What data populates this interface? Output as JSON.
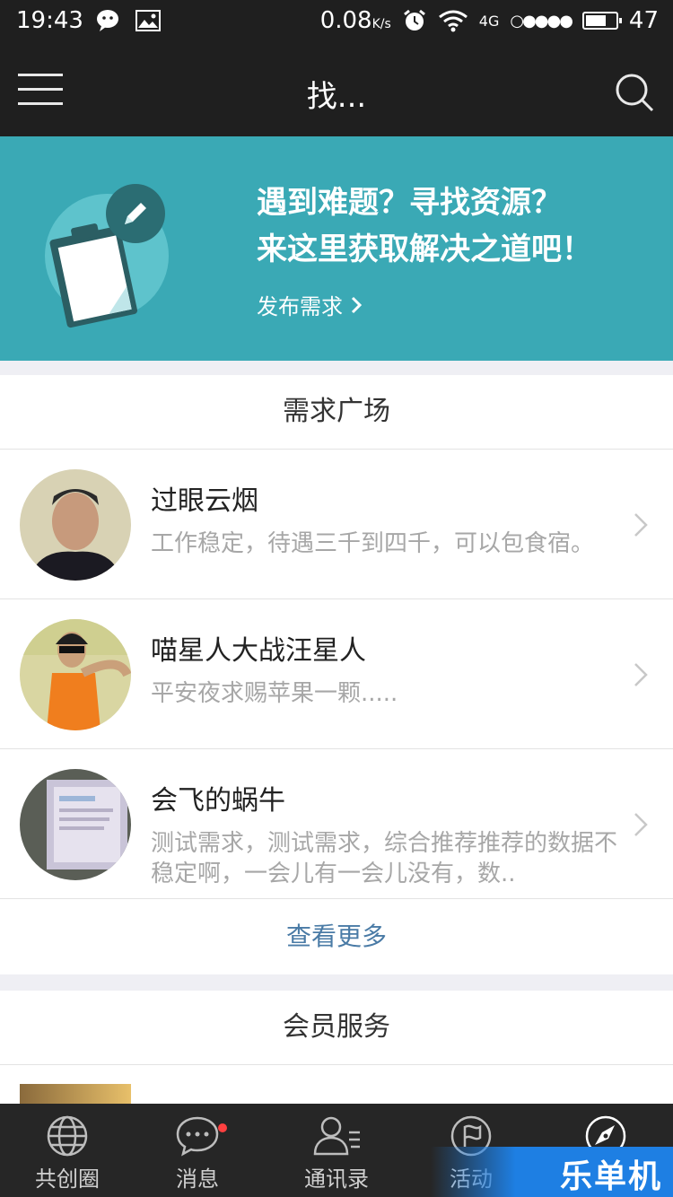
{
  "status_bar": {
    "time": "19:43",
    "net_speed": "0.08",
    "net_speed_unit": "K/s",
    "network": "4G",
    "battery": "47"
  },
  "header": {
    "title": "找..."
  },
  "banner": {
    "line1": "遇到难题？寻找资源？",
    "line2": "来这里获取解决之道吧！",
    "publish_label": "发布需求"
  },
  "demand_square": {
    "title": "需求广场",
    "items": [
      {
        "name": "过眼云烟",
        "desc": "工作稳定，待遇三千到四千，可以包食宿。"
      },
      {
        "name": "喵星人大战汪星人",
        "desc": "平安夜求赐苹果一颗....."
      },
      {
        "name": "会飞的蜗牛",
        "desc": "测试需求，测试需求，综合推荐推荐的数据不稳定啊，一会儿有一会儿没有，数.."
      }
    ],
    "more_label": "查看更多"
  },
  "member_service": {
    "title": "会员服务"
  },
  "tabbar": {
    "items": [
      {
        "label": "共创圈"
      },
      {
        "label": "消息"
      },
      {
        "label": "通讯录"
      },
      {
        "label": "活动"
      },
      {
        "label": ""
      }
    ]
  },
  "watermark": "乐单机",
  "colors": {
    "banner_bg": "#3aa9b5",
    "dark_bar": "#1f1f1f",
    "link": "#4a7ba6"
  }
}
